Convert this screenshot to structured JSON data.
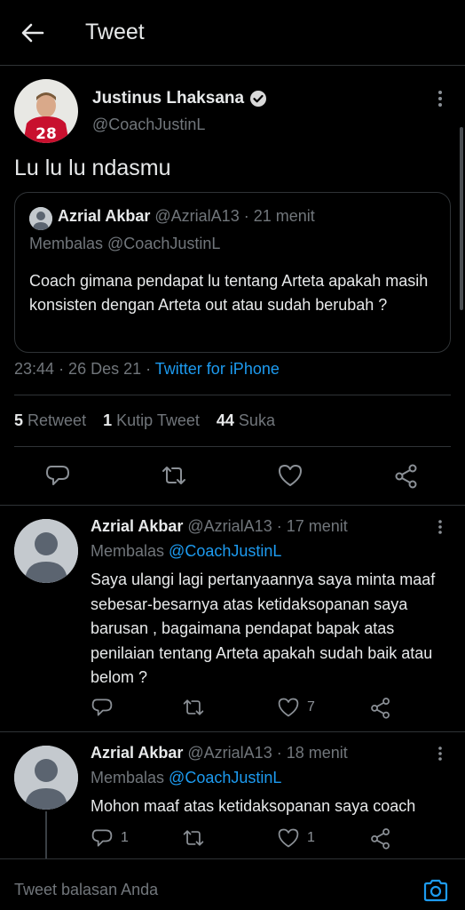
{
  "header": {
    "title": "Tweet"
  },
  "tweet": {
    "author_name": "Justinus Lhaksana",
    "handle": "@CoachJustinL",
    "jersey_number": "28",
    "text": "Lu lu lu ndasmu",
    "quote": {
      "name": "Azrial Akbar",
      "handle": "@AzrialA13",
      "time": "· 21 menit",
      "reply_to": "Membalas @CoachJustinL",
      "text": "Coach gimana pendapat lu tentang Arteta apakah masih konsisten dengan Arteta out atau sudah berubah ?"
    },
    "time": "23:44",
    "date": "· 26 Des 21 ·",
    "source": "Twitter for iPhone",
    "retweets": "5",
    "retweets_label": "Retweet",
    "quotes": "1",
    "quotes_label": "Kutip Tweet",
    "likes": "44",
    "likes_label": "Suka"
  },
  "replies": [
    {
      "name": "Azrial Akbar",
      "handle": "@AzrialA13",
      "time": "· 17 menit",
      "reply_prefix": "Membalas",
      "reply_to": "@CoachJustinL",
      "text": "Saya ulangi lagi pertanyaannya saya minta maaf sebesar-besarnya atas ketidaksopanan saya barusan , bagaimana pendapat bapak atas penilaian tentang Arteta apakah sudah baik atau belom ?",
      "reply_count": "",
      "retweet_count": "",
      "like_count": "7"
    },
    {
      "name": "Azrial Akbar",
      "handle": "@AzrialA13",
      "time": "· 18 menit",
      "reply_prefix": "Membalas",
      "reply_to": "@CoachJustinL",
      "text": "Mohon maaf atas ketidaksopanan saya coach",
      "reply_count": "1",
      "retweet_count": "",
      "like_count": "1"
    }
  ],
  "composer": {
    "placeholder": "Tweet balasan Anda"
  },
  "colors": {
    "background": "#000000",
    "link": "#1d9bf0",
    "muted": "#71767b",
    "divider": "#2f3336"
  }
}
